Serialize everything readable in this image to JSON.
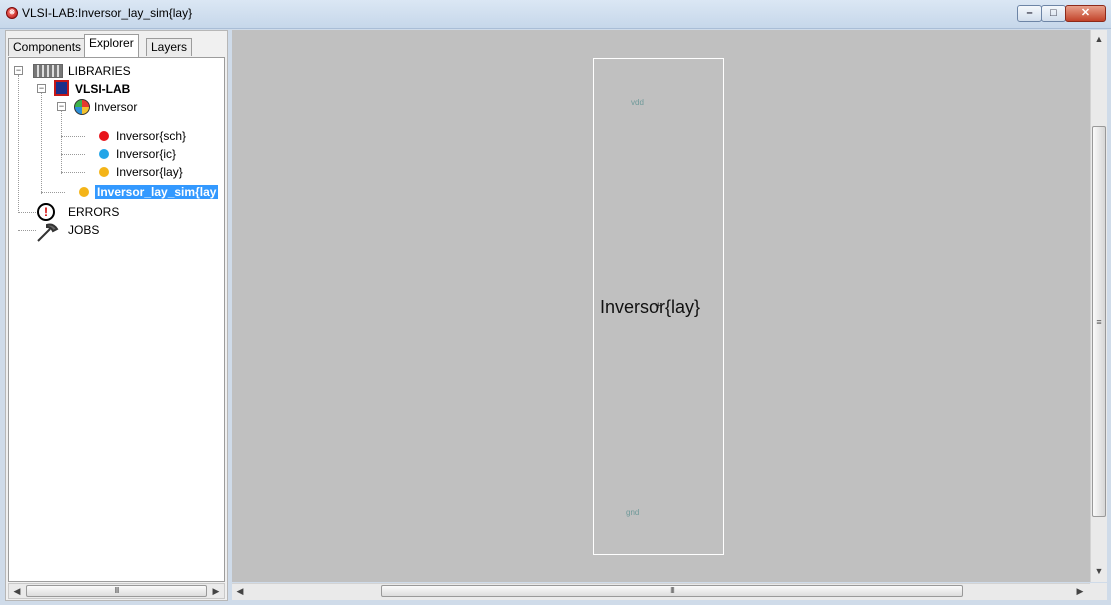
{
  "window": {
    "title": "VLSI-LAB:Inversor_lay_sim{lay}",
    "minimize_glyph": "–",
    "maximize_glyph": "□",
    "close_glyph": "✕"
  },
  "left_panel": {
    "tabs": [
      {
        "label": "Components",
        "active": false
      },
      {
        "label": "Explorer",
        "active": true
      },
      {
        "label": "Layers",
        "active": false
      }
    ],
    "tree": {
      "libraries": "LIBRARIES",
      "library": "VLSI-LAB",
      "cell_group": "Inversor",
      "views": [
        {
          "label": "Inversor{sch}",
          "color": "#e8141b"
        },
        {
          "label": "Inversor{ic}",
          "color": "#23a5e8"
        },
        {
          "label": "Inversor{lay}",
          "color": "#f4b418"
        }
      ],
      "selected_cell": {
        "label": "Inversor_lay_sim{lay",
        "color": "#f4b418"
      },
      "errors": "ERRORS",
      "jobs": "JOBS"
    },
    "hscroll_thumb": "III"
  },
  "canvas": {
    "cell_name": "Inversor{lay}",
    "port_top": "vdd",
    "port_bottom": "gnd",
    "center_marker": "+",
    "hscroll_thumb": "III",
    "vscroll_thumb": "≡"
  }
}
